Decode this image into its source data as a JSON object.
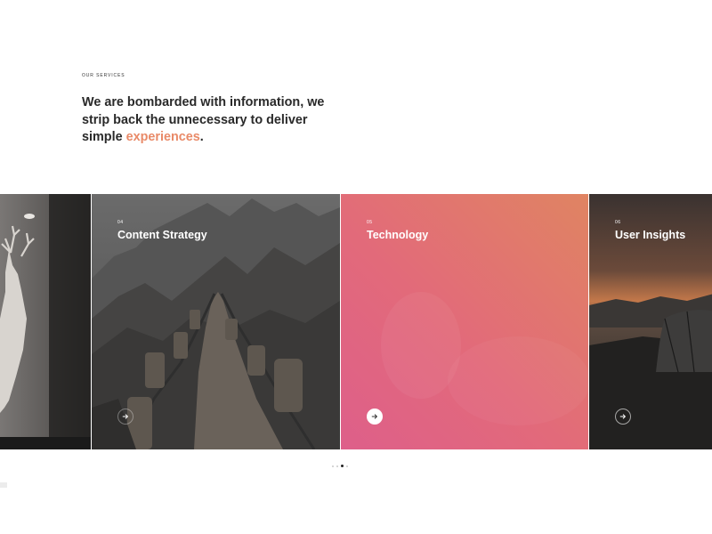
{
  "section": {
    "eyebrow": "OUR SERVICES",
    "headline_part1": "We are bombarded with information, we strip back the unnecessary to deliver simple ",
    "headline_accent": "experiences",
    "headline_end": ".",
    "accent_color": "#e98a68"
  },
  "slides": [
    {
      "number": "",
      "title": "",
      "image": "white deer sculpture on dark wall"
    },
    {
      "number": "04",
      "title": "Content Strategy",
      "image": "mountain ridge stone path with chain railings"
    },
    {
      "number": "05",
      "title": "Technology",
      "image": "pink-orange gradient overlay photo"
    },
    {
      "number": "06",
      "title": "User Insights",
      "image": "sunset sky over mountains with tent"
    }
  ],
  "carousel": {
    "dot_count": 4,
    "active_dot": 2
  },
  "icons": {
    "arrow": "arrow-right-icon"
  }
}
